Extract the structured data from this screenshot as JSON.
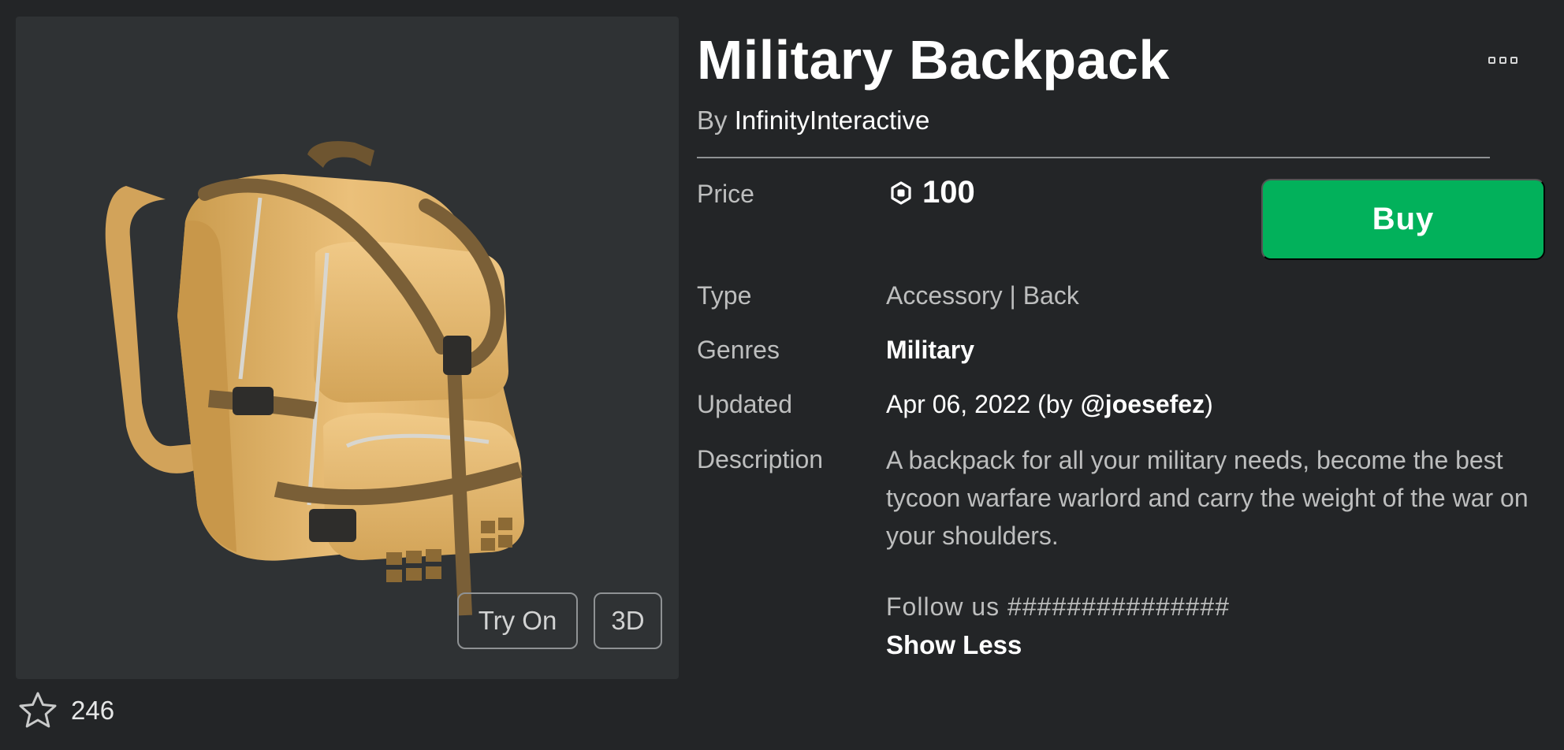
{
  "item": {
    "title": "Military Backpack",
    "by_prefix": "By",
    "creator": "InfinityInteractive",
    "more_icon": "ellipsis-icon"
  },
  "thumbnail": {
    "alt_icon": "backpack-3d-render",
    "try_on_label": "Try On",
    "three_d_label": "3D"
  },
  "favorites": {
    "icon": "star-outline-icon",
    "count": "246"
  },
  "price": {
    "label": "Price",
    "icon": "robux-icon",
    "amount": "100"
  },
  "buy_label": "Buy",
  "type": {
    "label": "Type",
    "value": "Accessory | Back"
  },
  "genres": {
    "label": "Genres",
    "value": "Military"
  },
  "updated": {
    "label": "Updated",
    "date": "Apr 06, 2022",
    "by_open": "(by",
    "user": "@joesefez",
    "by_close": ")"
  },
  "description": {
    "label": "Description",
    "text": "A backpack for all your military needs, become the best tycoon warfare warlord and carry the weight of the war on your shoulders.",
    "follow_text": "Follow us ###############",
    "toggle_label": "Show Less"
  },
  "colors": {
    "background": "#232527",
    "panel": "#2f3234",
    "buy_button": "#02b15b",
    "text_primary": "#ffffff",
    "text_secondary": "#bdbebe"
  }
}
